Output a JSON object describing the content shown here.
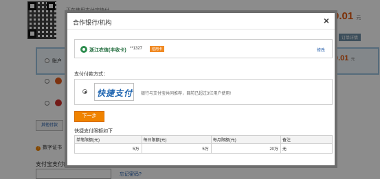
{
  "background": {
    "top_text": "正在使用支付宝快付.",
    "amount": "0.01",
    "amount_unit": "元",
    "detail_link": "订单详情",
    "method1_label": "账户",
    "amount2": "0.01",
    "amount2_unit": "元",
    "other_button": "其他付款",
    "warning_text": "数字证书",
    "password_label": "支付宝支付密码：",
    "forgot_link": "忘记密码?"
  },
  "modal": {
    "title": "合作银行/机构",
    "close_icon": "×",
    "bank": {
      "name": "浙江农信(丰收卡)",
      "card_number": "**1327",
      "card_type": "信用卡",
      "modify_link": "修改"
    },
    "pay_method_label": "支付付款方式：",
    "pay_option": {
      "logo_text": "快捷支付",
      "description": "银行与支付宝共同推荐，目前已超过3亿用户使用!"
    },
    "next_button": "下一步",
    "limits": {
      "title": "快捷支付限额如下",
      "headers": [
        "单笔限额(元)",
        "每日限额(元)",
        "每月限额(元)",
        "备注"
      ],
      "row": [
        "5万",
        "5万",
        "20万",
        "无"
      ]
    }
  },
  "colors": {
    "accent": "#f08300",
    "link": "#1d58a8",
    "bank_green": "#1f6b3b"
  }
}
